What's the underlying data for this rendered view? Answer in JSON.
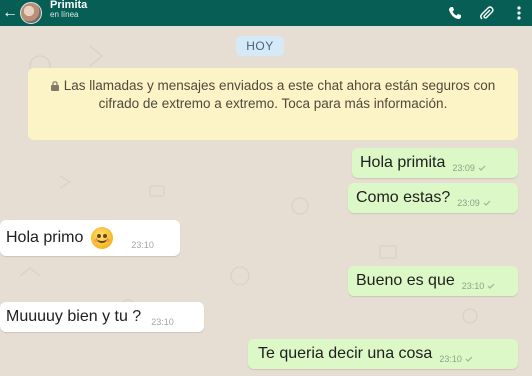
{
  "header": {
    "contact_name": "Primita",
    "status": "en línea",
    "icons": [
      "back-arrow-icon",
      "avatar",
      "phone-icon",
      "attach-icon",
      "more-options-icon"
    ],
    "color": "#075e54"
  },
  "date_label": "HOY",
  "encryption_notice": "Las llamadas y mensajes enviados a este chat ahora están seguros con cifrado de extremo a extremo. Toca para más información.",
  "messages": [
    {
      "direction": "outgoing",
      "text": "Hola primita",
      "time": "23:09"
    },
    {
      "direction": "outgoing",
      "text": "Como estas?",
      "time": "23:09"
    },
    {
      "direction": "incoming",
      "text": "Hola primo",
      "time": "23:10",
      "emoji": "smiling-face-emoji"
    },
    {
      "direction": "outgoing",
      "text": "Bueno es que",
      "time": "23:10"
    },
    {
      "direction": "incoming",
      "text": "Muuuuy bien y tu ?",
      "time": "23:10"
    },
    {
      "direction": "outgoing",
      "text": "Te queria decir una cosa",
      "time": "23:10"
    }
  ],
  "colors": {
    "outgoing_bubble": "#dcf8c6",
    "incoming_bubble": "#ffffff",
    "notice_bg": "#fcf3c7",
    "date_pill_bg": "#d6e9f6"
  }
}
